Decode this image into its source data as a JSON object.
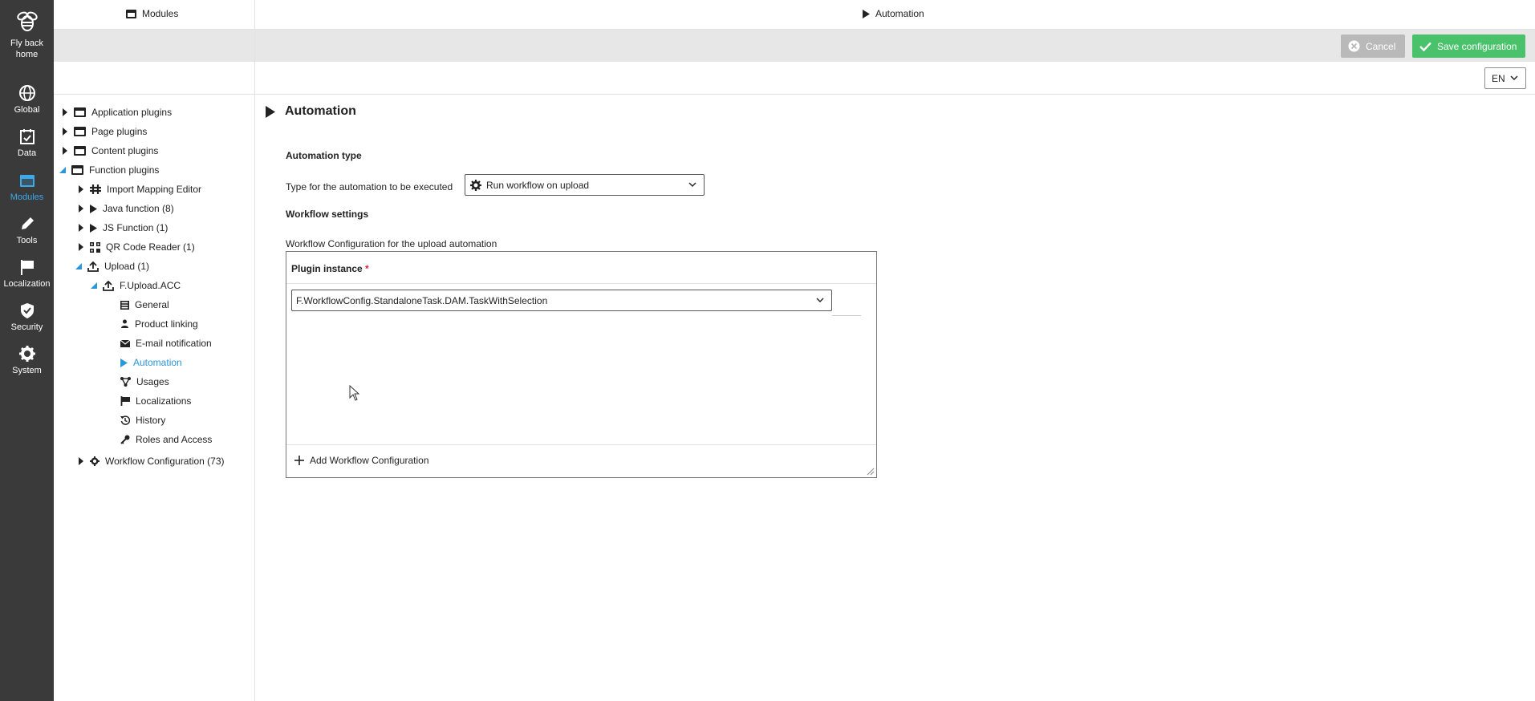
{
  "rail": {
    "home_label_1": "Fly back",
    "home_label_2": "home",
    "items": [
      {
        "label": "Global",
        "icon": "globe-icon"
      },
      {
        "label": "Data",
        "icon": "data-icon"
      },
      {
        "label": "Modules",
        "icon": "modules-icon",
        "active": true
      },
      {
        "label": "Tools",
        "icon": "pencil-icon"
      },
      {
        "label": "Localization",
        "icon": "flag-icon"
      },
      {
        "label": "Security",
        "icon": "shield-icon"
      },
      {
        "label": "System",
        "icon": "gear-icon"
      }
    ],
    "active_color": "#3ea9e8"
  },
  "header": {
    "left_title": "Modules",
    "center_title": "Automation"
  },
  "actions": {
    "cancel_label": "Cancel",
    "save_label": "Save configuration",
    "save_color": "#4ac26b",
    "cancel_color": "#b9b9b9"
  },
  "language": {
    "value": "EN"
  },
  "tree": {
    "items": [
      {
        "label": "Application plugins"
      },
      {
        "label": "Page plugins"
      },
      {
        "label": "Content plugins"
      },
      {
        "label": "Function plugins"
      },
      {
        "label": "Import Mapping Editor"
      },
      {
        "label": "Java function (8)"
      },
      {
        "label": "JS Function (1)"
      },
      {
        "label": "QR Code Reader (1)"
      },
      {
        "label": "Upload (1)"
      },
      {
        "label": "F.Upload.ACC"
      },
      {
        "label": "General"
      },
      {
        "label": "Product linking"
      },
      {
        "label": "E-mail notification"
      },
      {
        "label": "Automation"
      },
      {
        "label": "Usages"
      },
      {
        "label": "Localizations"
      },
      {
        "label": "History"
      },
      {
        "label": "Roles and Access"
      },
      {
        "label": "Workflow Configuration (73)"
      }
    ],
    "selected_color": "#2b97d6"
  },
  "main": {
    "title": "Automation",
    "automation_type_heading": "Automation type",
    "type_field_label": "Type for the automation to be executed",
    "type_value": "Run workflow on upload",
    "workflow_settings_heading": "Workflow settings",
    "workflow_config_label": "Workflow Configuration for the upload automation",
    "plugin_instance_label": "Plugin instance",
    "required_mark": "*",
    "plugin_instance_value": "F.WorkflowConfig.StandaloneTask.DAM.TaskWithSelection",
    "add_label": "Add Workflow Configuration"
  }
}
